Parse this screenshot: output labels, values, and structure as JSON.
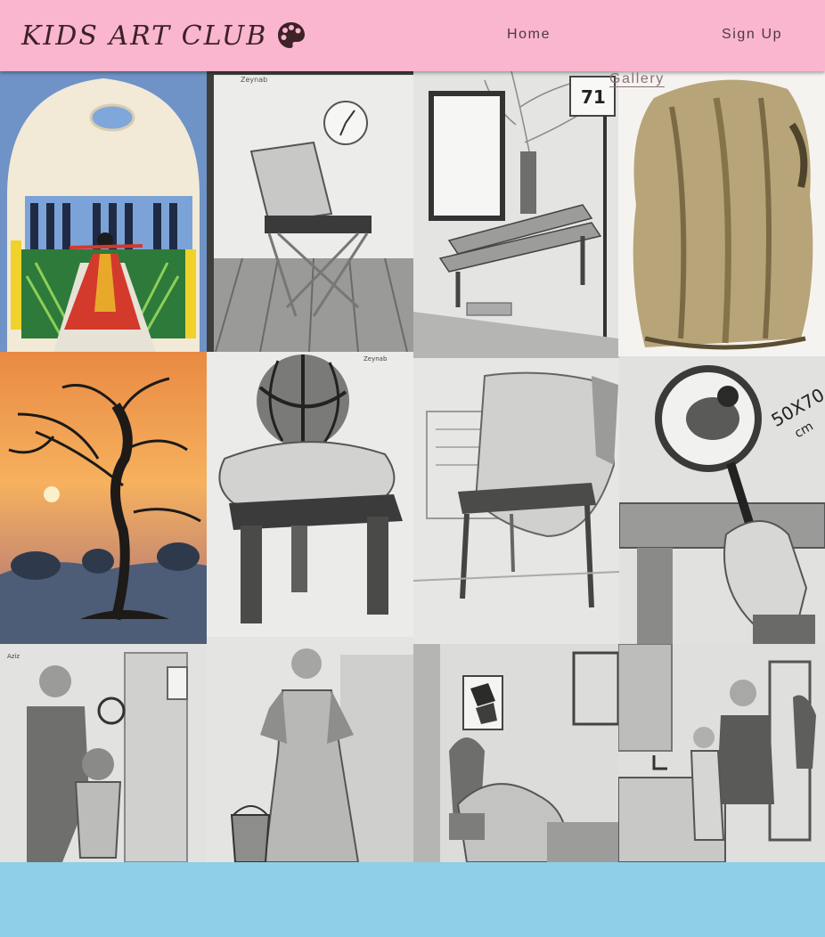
{
  "header": {
    "logo_text": "KIDS ART CLUB",
    "logo_icon": "palette-icon"
  },
  "nav": {
    "items": [
      {
        "label": "Home"
      },
      {
        "label": "Gallery",
        "active": true
      },
      {
        "label": "Sign Up"
      }
    ]
  },
  "colors": {
    "header_bg": "#fbb6cf",
    "page_bg": "#8fcfe8",
    "nav_text": "#4a3a3e",
    "nav_active": "#8a6f76"
  },
  "gallery": {
    "artworks": [
      {
        "subject": "painting of a woman in a red dress in an arched courtyard"
      },
      {
        "subject": "pencil drawing of a folding chair with cloth and a wall clock"
      },
      {
        "subject": "pencil drawing of a park bench with a tree and sign 71"
      },
      {
        "subject": "colored pencil drawing of draped cloth"
      },
      {
        "subject": "painting of a bare tree at sunset"
      },
      {
        "subject": "pencil drawing of a basketball on a cushion on a stool"
      },
      {
        "subject": "pencil drawing of a cloth draped over a chair"
      },
      {
        "subject": "pencil drawing of a hand holding a magnifying glass"
      },
      {
        "subject": "pencil drawing of a man helping a child at a door"
      },
      {
        "subject": "pencil drawing of a woman with a bucket"
      },
      {
        "subject": "pencil drawing of a room with an armchair and shelf"
      },
      {
        "subject": "pencil drawing of a woman and child at a sink"
      }
    ],
    "image_texts": {
      "sign_number": "71",
      "size_label": "50X70",
      "size_unit": "cm"
    }
  }
}
